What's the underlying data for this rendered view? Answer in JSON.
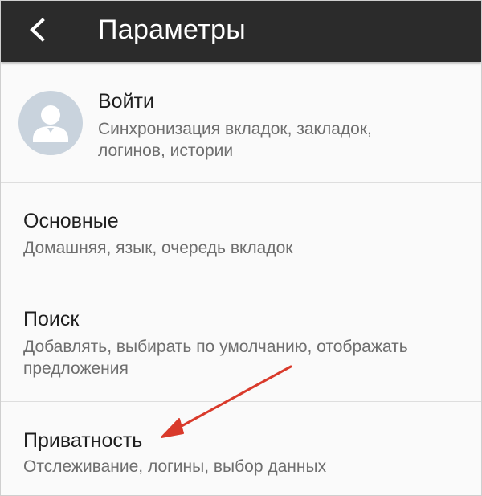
{
  "header": {
    "title": "Параметры",
    "back_icon": "chevron-left-icon"
  },
  "account": {
    "title": "Войти",
    "subtitle_line1": "Синхронизация вкладок, закладок,",
    "subtitle_line2": "логинов, истории",
    "avatar_icon": "user-avatar-icon"
  },
  "settings": [
    {
      "title": "Основные",
      "subtitle_line1": "Домашняя, язык, очередь вкладок"
    },
    {
      "title": "Поиск",
      "subtitle_line1": "Добавлять, выбирать по умолчанию, отображать",
      "subtitle_line2": "предложения"
    },
    {
      "title": "Приватность",
      "subtitle_line1": "Отслеживание, логины, выбор данных"
    }
  ],
  "colors": {
    "toolbar": "#2b2b2b",
    "background": "#fafafa",
    "annotation_arrow": "#d93a2b",
    "avatar_bg": "#c9d3dd"
  }
}
